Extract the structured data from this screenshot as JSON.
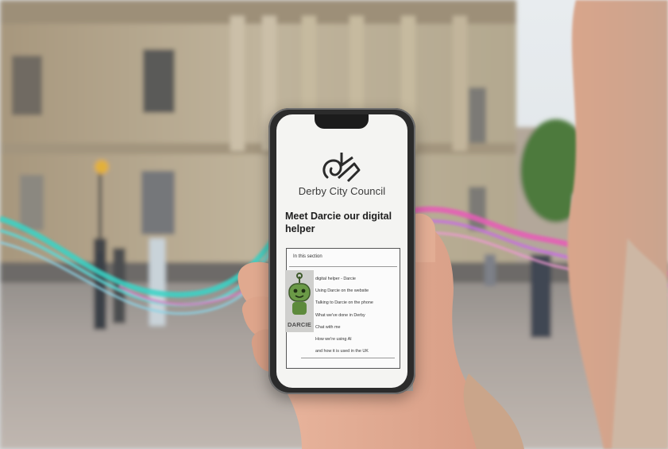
{
  "photo": {
    "subject": "hand holding smartphone in front of city building"
  },
  "phone_screen": {
    "council_name": "Derby City Council",
    "page_title": "Meet Darcie our digital helper",
    "section_heading": "In this section",
    "section_items": [
      "digital helper - Darcie",
      "Using Darcie on the website",
      "Talking to Darcie on the phone",
      "What we've done in Derby",
      "Chat with me",
      "How we're using AI",
      "and how it is used in the UK"
    ],
    "bot_label": "DARCIE",
    "icons": {
      "logo": "derby-ram-logo-icon",
      "bot": "robot-icon"
    }
  },
  "colors": {
    "ribbon_teal": "#3fd6c8",
    "ribbon_pink": "#e63fb0",
    "bot_green": "#6b9a47",
    "stone": "#b7a88f"
  }
}
